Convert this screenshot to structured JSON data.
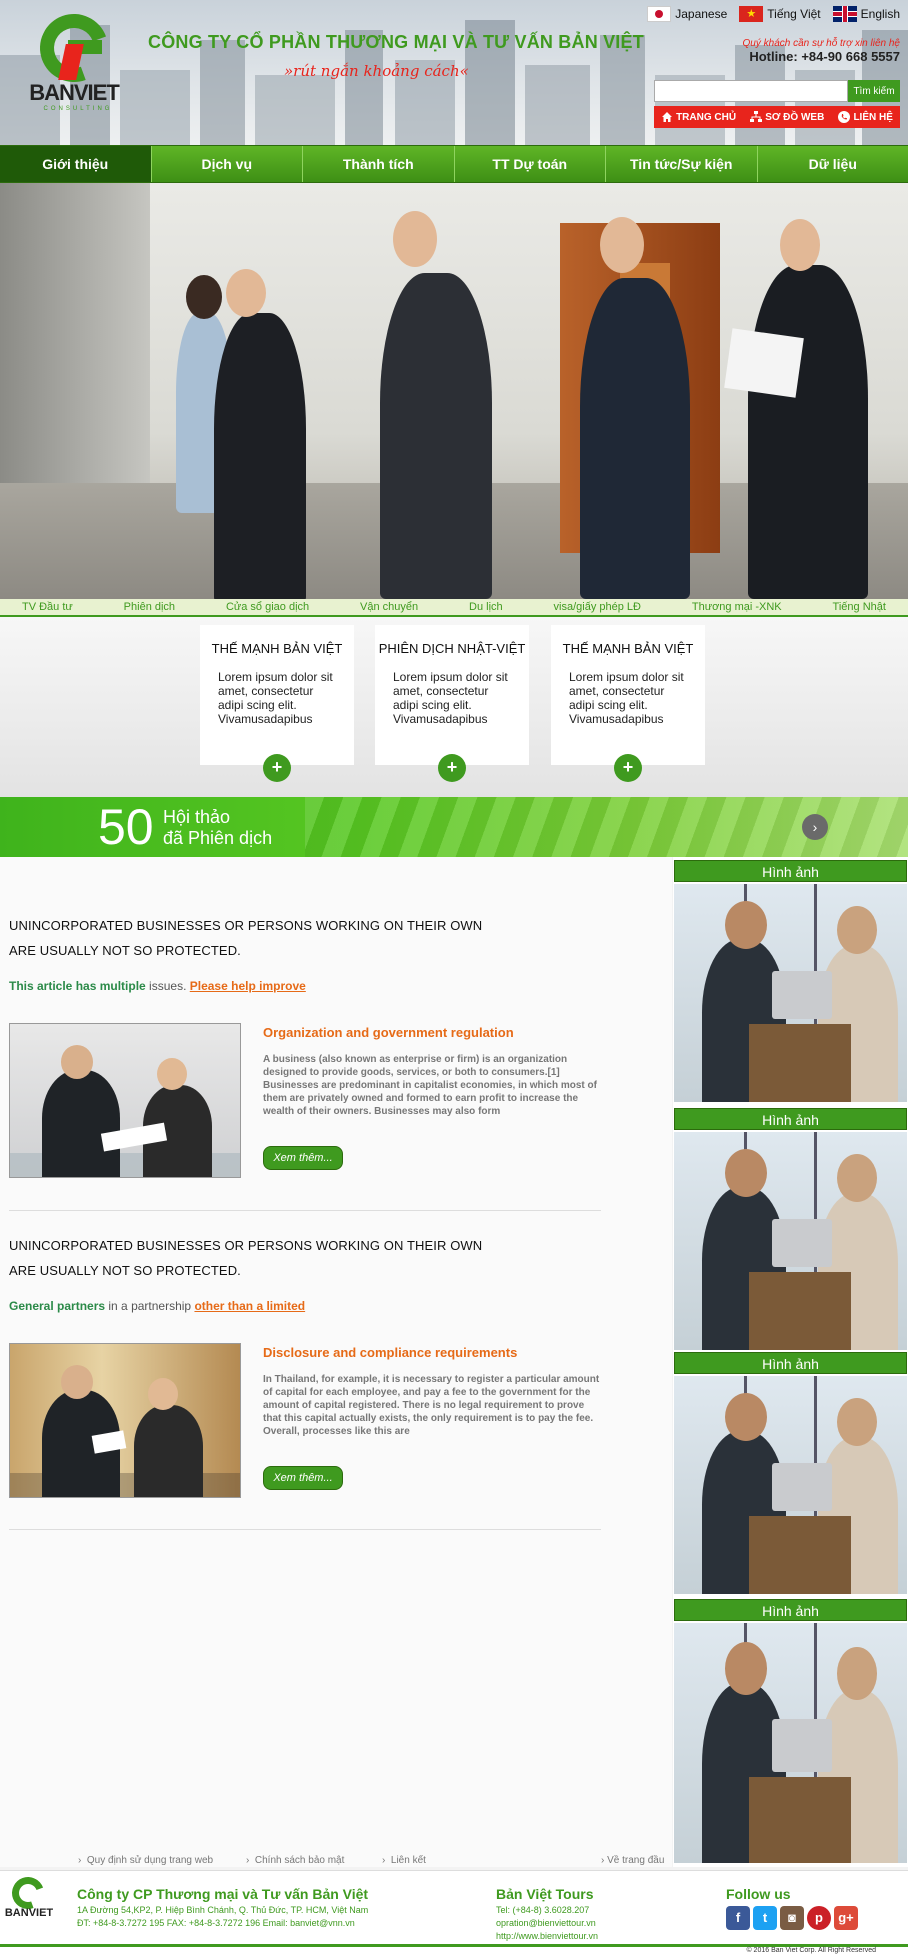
{
  "header": {
    "logo_text": "BANVIET",
    "logo_sub": "CONSULTING",
    "company_name": "CÔNG TY CỔ PHẦN THƯƠNG MẠI VÀ TƯ VẤN BẢN VIỆT",
    "slogan": "»rút ngắn khoảng cách«",
    "languages": [
      "Japanese",
      "Tiếng Việt",
      "English"
    ],
    "support_text": "Quý khách cần sự hỗ trợ xin liên hệ",
    "hotline": "Hotline: +84-90 668 5557",
    "search_placeholder": "",
    "search_button": "Tìm kiếm",
    "top_links": [
      "TRANG CHỦ",
      "SƠ ĐỒ WEB",
      "LIÊN HỆ"
    ]
  },
  "nav": [
    "Giới thiệu",
    "Dịch vụ",
    "Thành tích",
    "TT Dự toán",
    "Tin tức/Sự kiện",
    "Dữ liệu"
  ],
  "slider": {
    "dots": 7,
    "active_dot": 1
  },
  "service_links": [
    "TV Đầu tư",
    "Phiên dịch",
    "Cửa sổ giao dịch",
    "Vận chuyển",
    "Du lịch",
    "visa/giấy phép LĐ",
    "Thương mại -XNK",
    "Tiếng Nhật"
  ],
  "features": [
    {
      "title": "THẾ MẠNH BẢN VIỆT",
      "text": "Lorem ipsum dolor sit amet, consectetur adipi   scing elit. Vivamusadapibus",
      "plus": "+"
    },
    {
      "title": "PHIÊN DỊCH NHẬT-VIỆT",
      "text": "Lorem ipsum dolor sit amet, consectetur adipi   scing elit. Vivamusadapibus",
      "plus": "+"
    },
    {
      "title": "THẾ MẠNH BẢN VIỆT",
      "text": "Lorem ipsum dolor sit amet, consectetur adipi   scing elit. Vivamusadapibus",
      "plus": "+"
    }
  ],
  "banner": {
    "number": "50",
    "line1": "Hội thảo",
    "line2": "đã Phiên dịch",
    "arrow": "›"
  },
  "articles": [
    {
      "heading1": "UNINCORPORATED BUSINESSES OR PERSONS WORKING ON THEIR OWN",
      "heading2": "ARE USUALLY NOT SO PROTECTED.",
      "meta_green": "This article has multiple",
      "meta_gray": " issues.",
      "meta_link": "Please help improve",
      "title": "Organization and government regulation",
      "text": "A business (also known as enterprise or firm) is an organization designed to provide goods, services, or both to consumers.[1] Businesses are predominant in capitalist economies, in which most of them are privately owned and formed to earn profit to increase the wealth of their owners. Businesses may also form",
      "more": "Xem thêm..."
    },
    {
      "heading1": "UNINCORPORATED BUSINESSES OR PERSONS WORKING ON THEIR OWN",
      "heading2": "ARE USUALLY NOT SO PROTECTED.",
      "meta_green": "General partners",
      "meta_gray": " in a partnership",
      "meta_link": "other than a limited",
      "title": "Disclosure and compliance requirements",
      "text": "In Thailand, for example, it is necessary to register a particular amount of capital for each employee, and pay a fee to the government for the amount of capital registered. There is no legal requirement to prove that this capital actually exists, the only requirement is to pay the fee. Overall, processes like this are",
      "more": "Xem thêm..."
    }
  ],
  "sidebar": {
    "title": "Hình ảnh",
    "count": 4
  },
  "footer_links": [
    "Quy định sử dụng trang web",
    "Chính sách bảo mật",
    "Liên kết",
    "Về trang đầu"
  ],
  "footer": {
    "company": "Công ty CP Thương mại và Tư vấn Bản Việt",
    "address": "1A Đường 54,KP2, P. Hiệp Bình Chánh, Q. Thủ Đức, TP. HCM, Việt Nam",
    "contact": "ĐT: +84-8-3.7272 195     FAX: +84-8-3.7272 196 Email: banviet@vnn.vn",
    "tours_title": "Bản Việt Tours",
    "tours_tel": "Tel: (+84-8) 3.6028.207",
    "tours_email": "opration@bienviettour.vn",
    "tours_web": "http://www.bienviettour.vn",
    "follow": "Follow us",
    "copyright": "© 2016  Ban Viet Corp. All Right Reserved"
  },
  "colors": {
    "brand_green": "#3f9a1f",
    "accent_red": "#e8241c",
    "link_orange": "#e66a17"
  }
}
